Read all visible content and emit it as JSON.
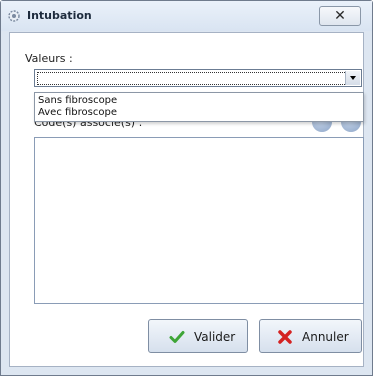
{
  "window": {
    "title": "Intubation",
    "close_symbol": "✕",
    "icon": "gear-icon"
  },
  "form": {
    "values_label": "Valeurs :",
    "select_value": "",
    "dropdown_options": [
      "Sans fibroscope",
      "Avec fibroscope"
    ],
    "codes_label": "Code(s) associé(s) :",
    "codes_value": ""
  },
  "buttons": {
    "ok_label": "Valider",
    "cancel_label": "Annuler"
  },
  "colors": {
    "accent_check": "#3ea537",
    "accent_cross": "#d42222"
  }
}
